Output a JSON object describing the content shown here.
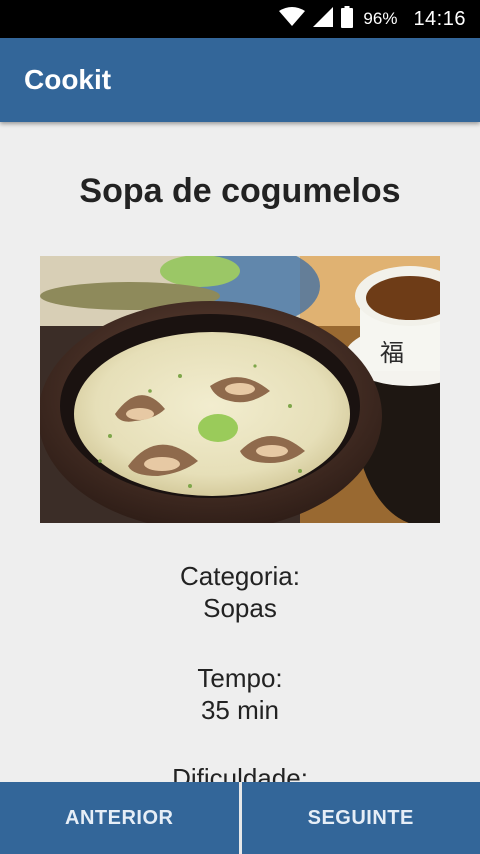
{
  "status_bar": {
    "battery_percent": "96%",
    "time": "14:16",
    "icons": [
      "wifi-icon",
      "signal-icon",
      "battery-icon"
    ]
  },
  "app_bar": {
    "title": "Cookit"
  },
  "recipe": {
    "title": "Sopa de cogumelos",
    "image_description_icon": "soup-photo",
    "fields": [
      {
        "label": "Categoria:",
        "value": "Sopas"
      },
      {
        "label": "Tempo:",
        "value": "35 min"
      },
      {
        "label": "Dificuldade:",
        "value": ""
      }
    ]
  },
  "bottom_nav": {
    "previous_label": "ANTERIOR",
    "next_label": "SEGUINTE"
  },
  "colors": {
    "primary": "#336699",
    "background": "#eeeeee",
    "status_bar": "#000000"
  }
}
